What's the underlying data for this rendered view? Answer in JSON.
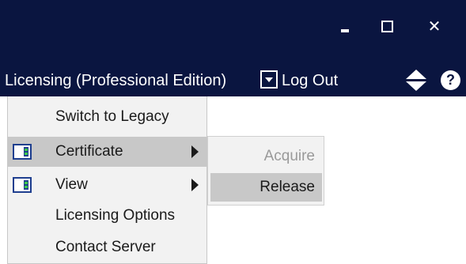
{
  "window": {
    "minimize_icon": "minimize-icon",
    "maximize_icon": "maximize-icon",
    "close_icon": "close-icon",
    "close_glyph": "✕"
  },
  "header": {
    "title": "Licensing (Professional Edition)",
    "logout_label": "Log Out",
    "help_glyph": "?",
    "background_color": "#0a1540"
  },
  "menu": {
    "items": [
      {
        "label": "Switch to Legacy",
        "has_icon": false,
        "has_submenu": false,
        "highlighted": false
      },
      {
        "label": "Certificate",
        "has_icon": true,
        "has_submenu": true,
        "highlighted": true
      },
      {
        "label": "View",
        "has_icon": true,
        "has_submenu": true,
        "highlighted": false
      },
      {
        "label": "Licensing Options",
        "has_icon": false,
        "has_submenu": false,
        "highlighted": false
      },
      {
        "label": "Contact Server",
        "has_icon": false,
        "has_submenu": false,
        "highlighted": false
      }
    ]
  },
  "submenu": {
    "items": [
      {
        "label": "Acquire",
        "enabled": false,
        "highlighted": false
      },
      {
        "label": "Release",
        "enabled": true,
        "highlighted": true
      }
    ]
  }
}
